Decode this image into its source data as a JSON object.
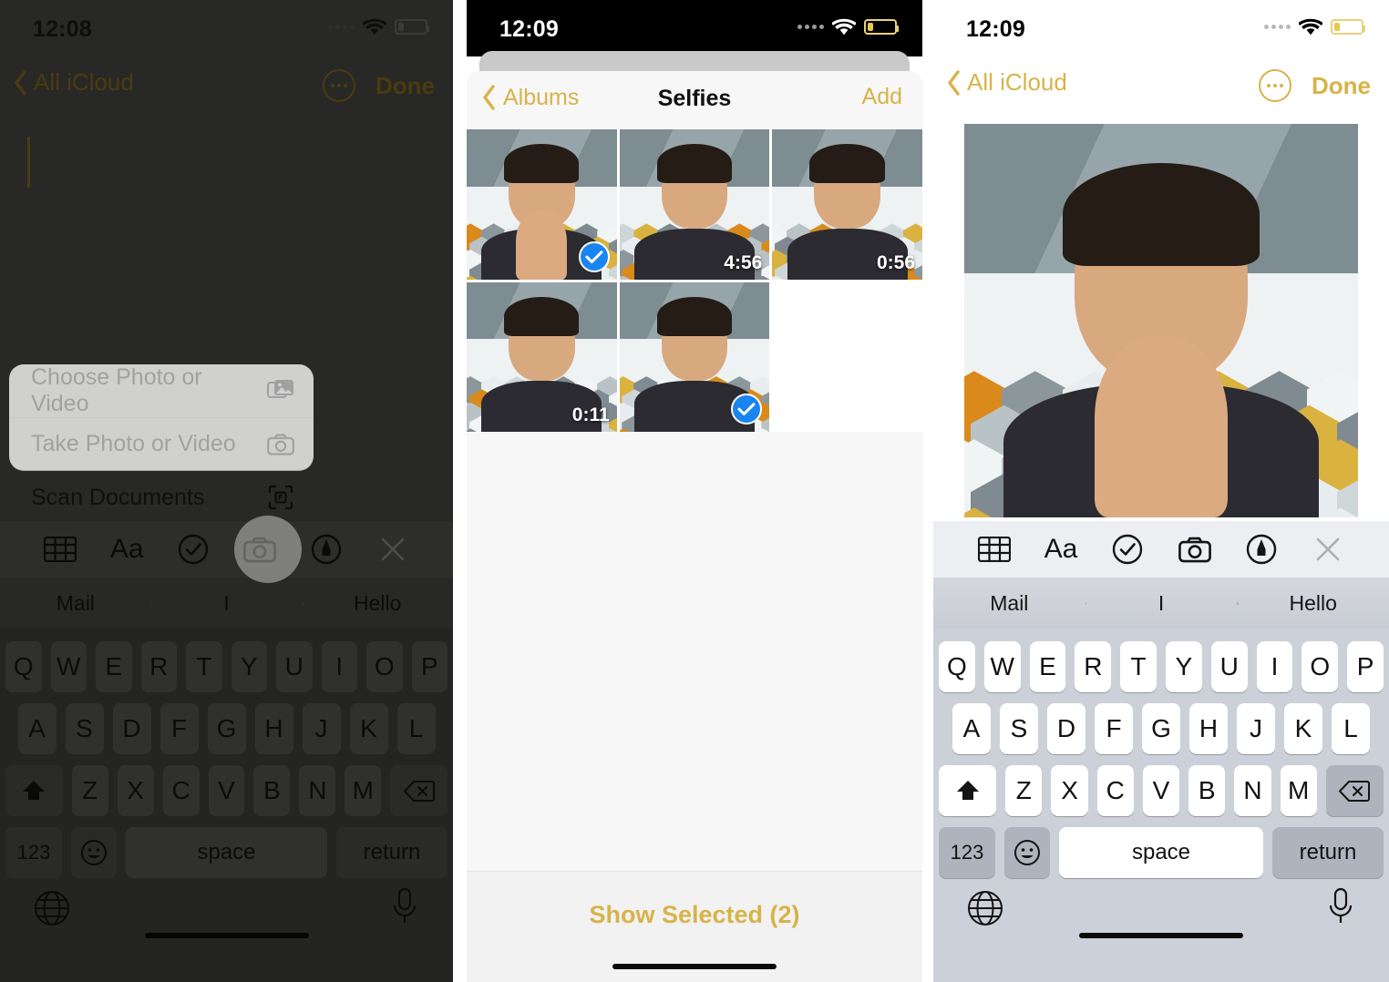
{
  "panels": [
    {
      "id": "notes-attachment-menu",
      "status": {
        "time": "12:08",
        "wifi_icon": "wifi-icon",
        "battery_icon": "battery-low-icon",
        "cellular_icon": "signal-dots-icon"
      },
      "nav": {
        "back_label": "All iCloud",
        "back_icon": "chevron-left-icon",
        "more_icon": "ellipsis-circle-icon",
        "done_label": "Done"
      },
      "context_menu": [
        {
          "label": "Choose Photo or Video",
          "icon": "photos-stack-icon"
        },
        {
          "label": "Take Photo or Video",
          "icon": "camera-icon"
        },
        {
          "label": "Scan Documents",
          "icon": "document-scan-icon"
        }
      ],
      "format_toolbar": [
        {
          "name": "table-icon",
          "label": ""
        },
        {
          "name": "text-format-icon",
          "label": "Aa"
        },
        {
          "name": "checklist-icon",
          "label": ""
        },
        {
          "name": "camera-icon",
          "label": "",
          "highlighted": true
        },
        {
          "name": "markup-pen-icon",
          "label": ""
        },
        {
          "name": "close-icon",
          "label": ""
        }
      ],
      "predictions": [
        "Mail",
        "I",
        "Hello"
      ],
      "keyboard": {
        "row1": [
          "Q",
          "W",
          "E",
          "R",
          "T",
          "Y",
          "U",
          "I",
          "O",
          "P"
        ],
        "row2": [
          "A",
          "S",
          "D",
          "F",
          "G",
          "H",
          "J",
          "K",
          "L"
        ],
        "row3": [
          "Z",
          "X",
          "C",
          "V",
          "B",
          "N",
          "M"
        ],
        "shift_icon": "shift-up-icon",
        "delete_icon": "backspace-icon",
        "numbers_label": "123",
        "emoji_icon": "emoji-smiley-icon",
        "space_label": "space",
        "return_label": "return",
        "globe_icon": "globe-icon",
        "mic_icon": "microphone-icon"
      }
    },
    {
      "id": "photos-album-picker",
      "status": {
        "time": "12:09",
        "wifi_icon": "wifi-icon",
        "battery_icon": "battery-low-icon",
        "cellular_icon": "signal-dots-icon"
      },
      "nav": {
        "back_label": "Albums",
        "back_icon": "chevron-left-icon",
        "title": "Selfies",
        "add_label": "Add"
      },
      "thumbnails": [
        {
          "index": 1,
          "selected": true,
          "duration": ""
        },
        {
          "index": 2,
          "selected": false,
          "duration": "4:56"
        },
        {
          "index": 3,
          "selected": false,
          "duration": "0:56"
        },
        {
          "index": 4,
          "selected": false,
          "duration": "0:11"
        },
        {
          "index": 5,
          "selected": true,
          "duration": ""
        }
      ],
      "footer": {
        "show_selected_label": "Show Selected (2)"
      }
    },
    {
      "id": "notes-photo-inserted",
      "status": {
        "time": "12:09",
        "wifi_icon": "wifi-icon",
        "battery_icon": "battery-low-icon",
        "cellular_icon": "signal-dots-icon"
      },
      "nav": {
        "back_label": "All iCloud",
        "back_icon": "chevron-left-icon",
        "more_icon": "ellipsis-circle-icon",
        "done_label": "Done"
      },
      "format_toolbar": [
        {
          "name": "table-icon",
          "label": ""
        },
        {
          "name": "text-format-icon",
          "label": "Aa"
        },
        {
          "name": "checklist-icon",
          "label": ""
        },
        {
          "name": "camera-icon",
          "label": ""
        },
        {
          "name": "markup-pen-icon",
          "label": ""
        },
        {
          "name": "close-icon",
          "label": ""
        }
      ],
      "predictions": [
        "Mail",
        "I",
        "Hello"
      ],
      "keyboard": {
        "row1": [
          "Q",
          "W",
          "E",
          "R",
          "T",
          "Y",
          "U",
          "I",
          "O",
          "P"
        ],
        "row2": [
          "A",
          "S",
          "D",
          "F",
          "G",
          "H",
          "J",
          "K",
          "L"
        ],
        "row3": [
          "Z",
          "X",
          "C",
          "V",
          "B",
          "N",
          "M"
        ],
        "shift_icon": "shift-up-icon",
        "delete_icon": "backspace-icon",
        "numbers_label": "123",
        "emoji_icon": "emoji-smiley-icon",
        "space_label": "space",
        "return_label": "return",
        "globe_icon": "globe-icon",
        "mic_icon": "microphone-icon"
      }
    }
  ],
  "colors": {
    "accent_gold": "#d7b349",
    "accent_gold_dim": "#8a6d1d",
    "selection_blue": "#1a85f0",
    "keyboard_light_bg": "#ccd0d8",
    "keyboard_dim_bg": "#444442"
  }
}
